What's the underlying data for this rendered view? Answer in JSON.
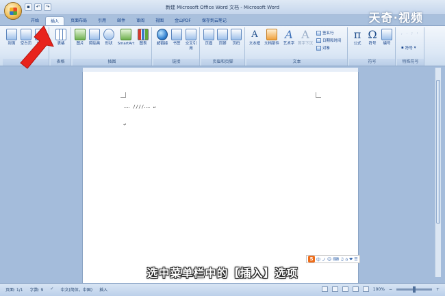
{
  "window": {
    "title": "新建 Microsoft Office Word 文档 - Microsoft Word"
  },
  "watermark": "天奇·视频",
  "quick_access": [
    "save",
    "undo",
    "redo"
  ],
  "tabs": [
    {
      "label": "开始",
      "active": false
    },
    {
      "label": "插入",
      "active": true
    },
    {
      "label": "页面布局",
      "active": false
    },
    {
      "label": "引用",
      "active": false
    },
    {
      "label": "邮件",
      "active": false
    },
    {
      "label": "审阅",
      "active": false
    },
    {
      "label": "视图",
      "active": false
    },
    {
      "label": "金山PDF",
      "active": false
    },
    {
      "label": "保存到云笔记",
      "active": false
    }
  ],
  "ribbon": {
    "pages": {
      "label": "页",
      "buttons": [
        "封面",
        "空白页",
        "分页"
      ]
    },
    "table": {
      "label": "表格",
      "buttons": [
        "表格"
      ]
    },
    "illustrations": {
      "label": "插图",
      "buttons": [
        "图片",
        "剪贴画",
        "形状",
        "SmartArt",
        "图表"
      ]
    },
    "links": {
      "label": "链接",
      "buttons": [
        "超链接",
        "书签",
        "交叉引用"
      ]
    },
    "header_footer": {
      "label": "页眉和页脚",
      "buttons": [
        "页眉",
        "页脚",
        "页码"
      ]
    },
    "text": {
      "label": "文本",
      "buttons": [
        "文本框",
        "文档部件",
        "艺术字",
        "首字下沉"
      ],
      "small": [
        "签名行",
        "日期和时间",
        "对象"
      ]
    },
    "symbols": {
      "label": "符号",
      "buttons": [
        "公式",
        "符号",
        "编号"
      ]
    },
    "special": {
      "label": "特殊符号",
      "buttons": [
        "符号"
      ]
    }
  },
  "document": {
    "line1": "‥‥  ////‥‥ ↵",
    "line2": "↵"
  },
  "ime": {
    "s_label": "S",
    "items": [
      "中",
      "ノ",
      "☺",
      "⌨",
      "♫",
      "⌂",
      "❤",
      "☰"
    ]
  },
  "subtitle": "选中菜单栏中的【插入】选项",
  "status": {
    "page": "页面: 1/1",
    "words": "字数: 9",
    "lang": "中文(简体，中国)",
    "mode": "插入",
    "zoom": "100%"
  },
  "colors": {
    "accent": "#15428b",
    "ribbon": "#dbe7f5",
    "arrow": "#e8231c"
  }
}
